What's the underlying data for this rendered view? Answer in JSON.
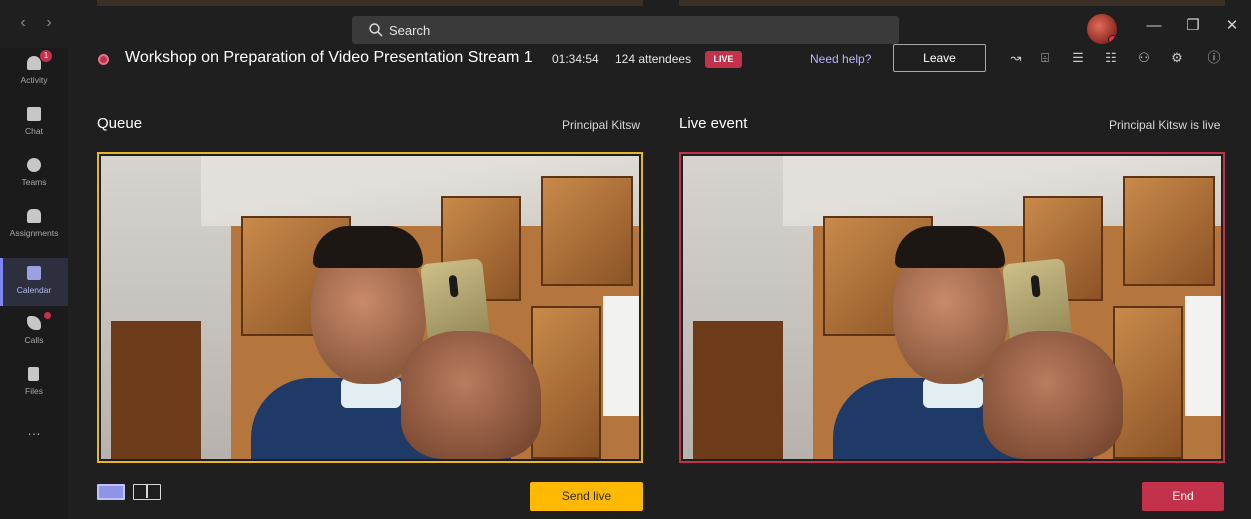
{
  "titlebar": {
    "search_placeholder": "Search",
    "back_icon": "chevron-left-icon",
    "forward_icon": "chevron-right-icon"
  },
  "rail": {
    "items": [
      {
        "label": "Activity",
        "icon": "bell-icon",
        "badge": "1"
      },
      {
        "label": "Chat",
        "icon": "chat-icon"
      },
      {
        "label": "Teams",
        "icon": "teams-icon"
      },
      {
        "label": "Assignments",
        "icon": "backpack-icon"
      },
      {
        "label": "Calendar",
        "icon": "calendar-icon",
        "active": true
      },
      {
        "label": "Calls",
        "icon": "phone-icon",
        "dot": true
      },
      {
        "label": "Files",
        "icon": "file-icon"
      },
      {
        "label": "…",
        "icon": "more-icon"
      }
    ]
  },
  "meeting": {
    "title": "Workshop on Preparation of Video Presentation Stream 1",
    "elapsed": "01:34:54",
    "attendees": "124 attendees",
    "live_badge": "LIVE",
    "help_link": "Need help?",
    "leave_label": "Leave"
  },
  "queue": {
    "title": "Queue",
    "presenter": "Principal Kitsw",
    "send_live_label": "Send live"
  },
  "live_event": {
    "title": "Live event",
    "status": "Principal Kitsw is live",
    "end_label": "End"
  },
  "colors": {
    "accent": "#7f85f5",
    "queue_border": "#e8b429",
    "live_border": "#c4314b",
    "send_live": "#ffb900",
    "end": "#c4314b"
  }
}
